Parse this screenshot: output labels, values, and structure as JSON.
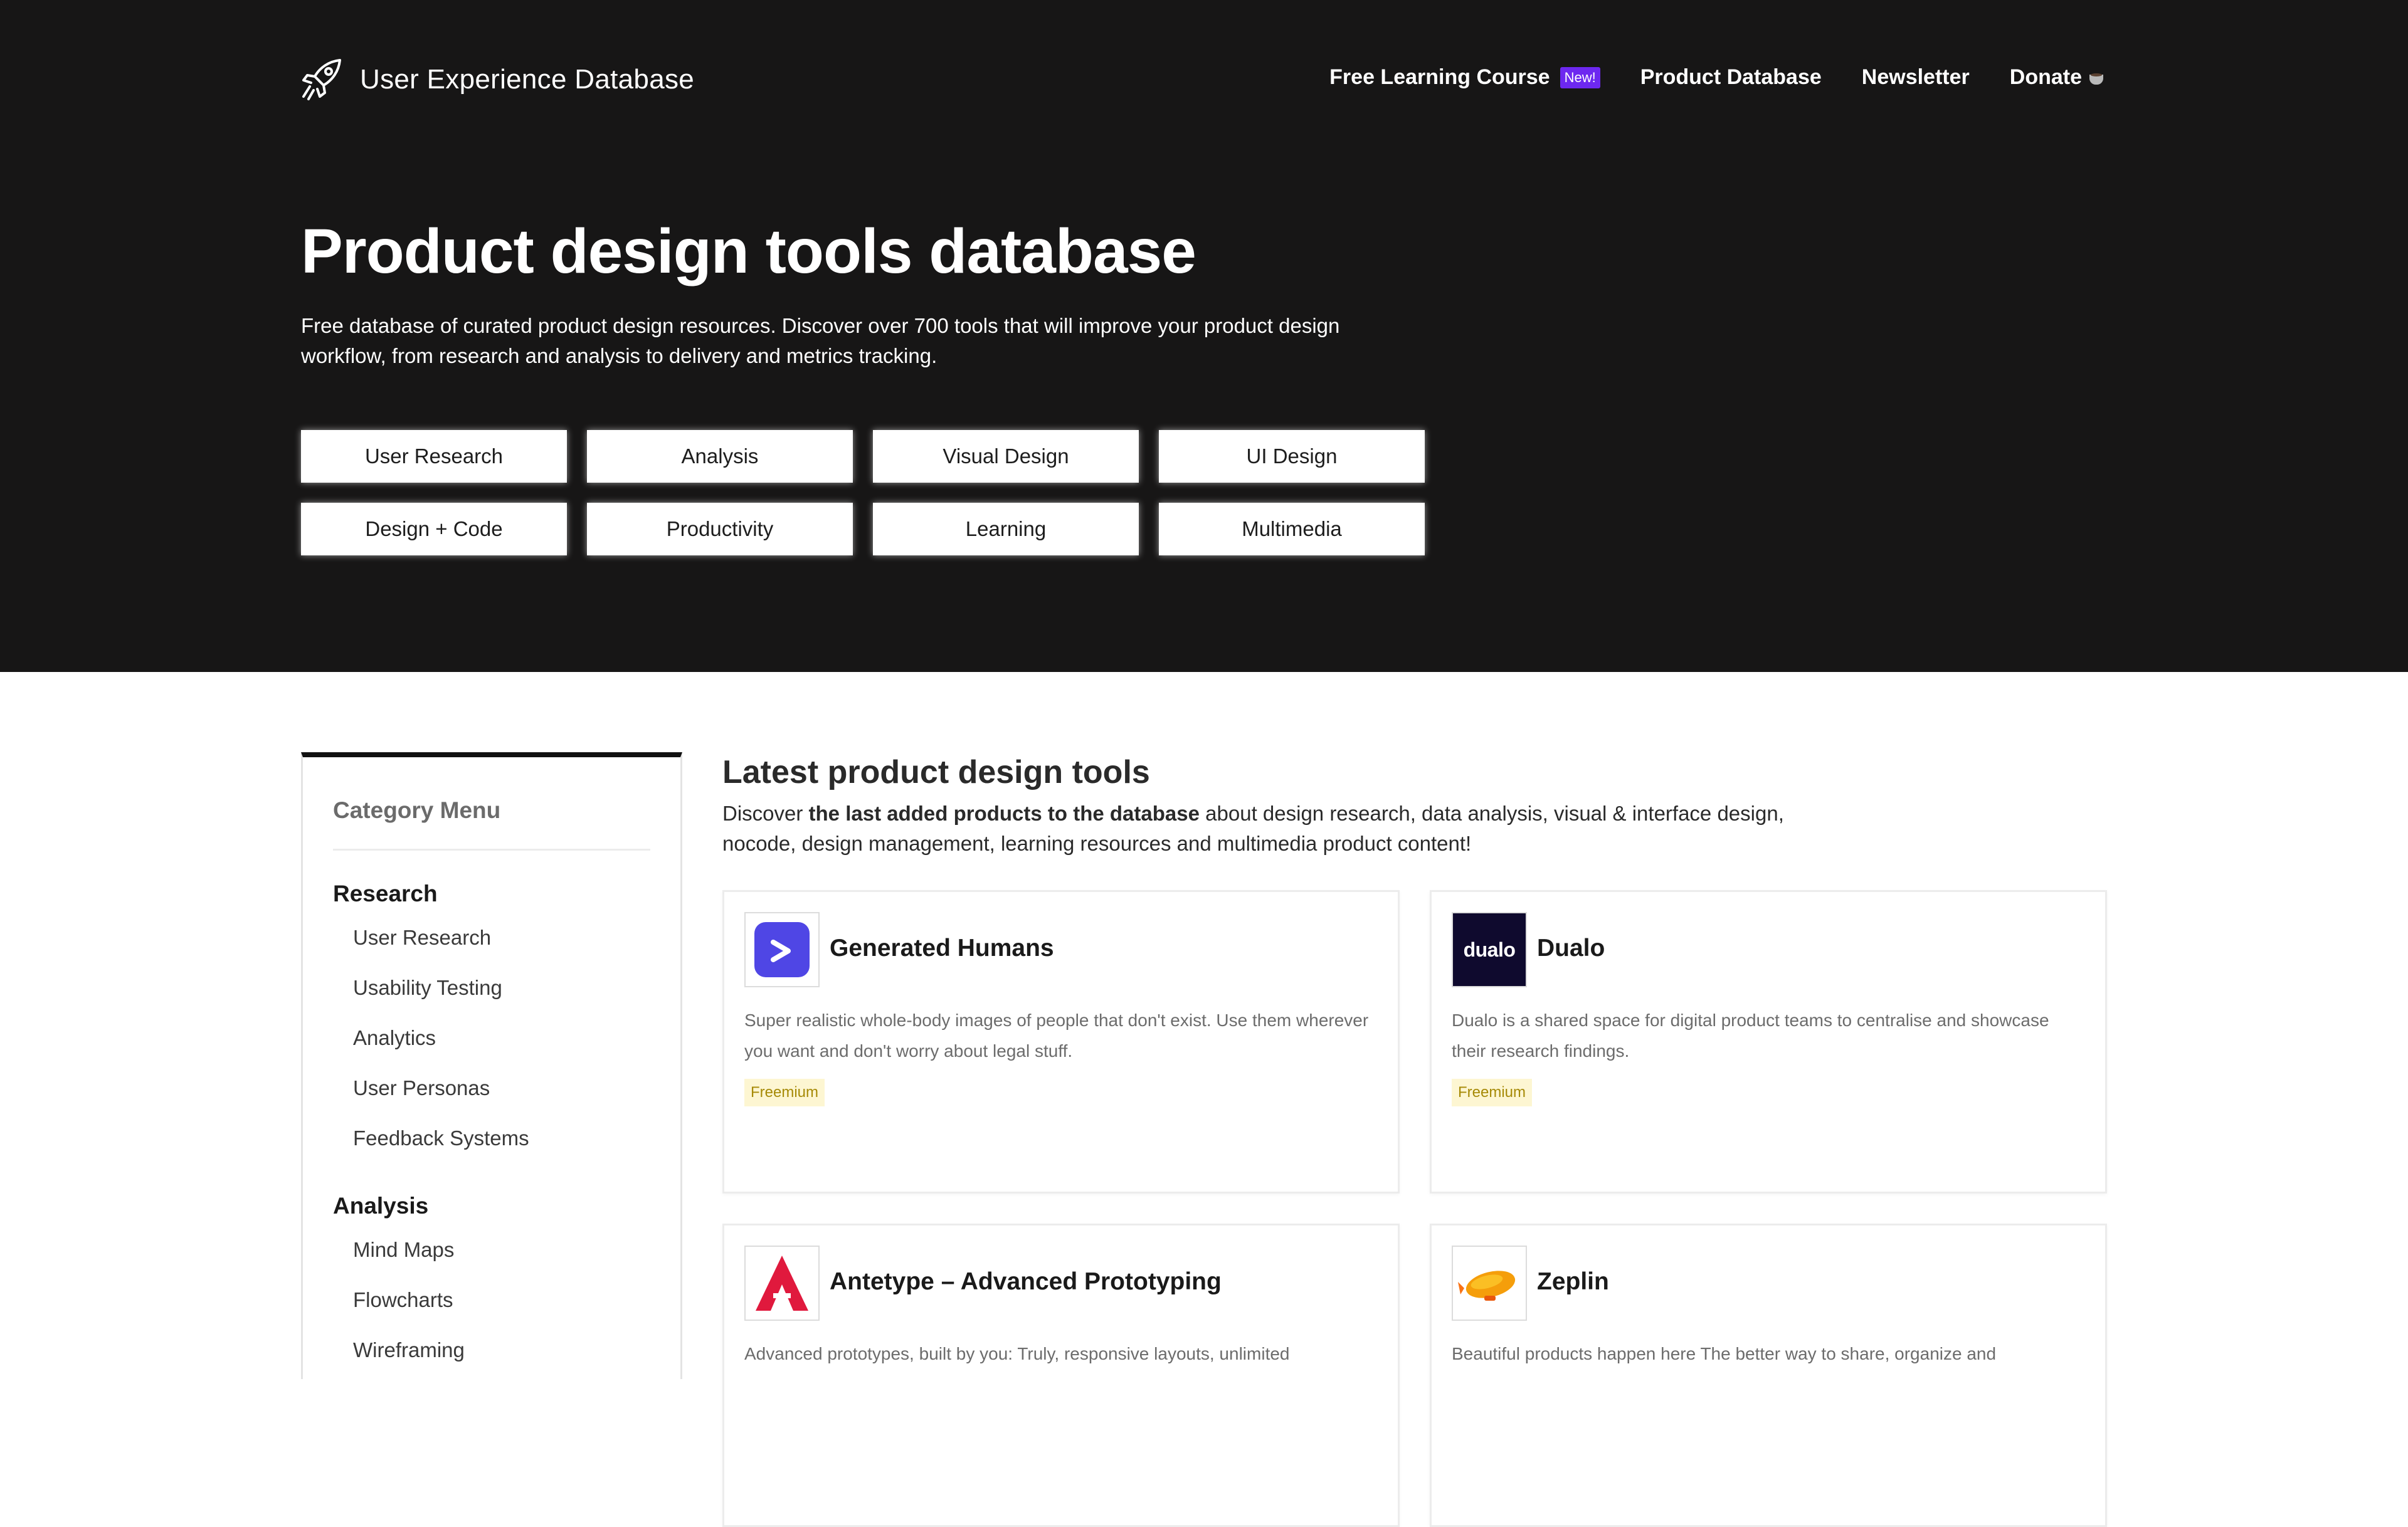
{
  "header": {
    "site_title": "User Experience Database",
    "nav": [
      {
        "label": "Free Learning Course",
        "badge": "New!"
      },
      {
        "label": "Product Database"
      },
      {
        "label": "Newsletter"
      },
      {
        "label": "Donate"
      }
    ]
  },
  "hero": {
    "title": "Product design tools database",
    "description": "Free database of curated product design resources. Discover over 700 tools that will improve your product design workflow, from research and analysis to delivery and metrics tracking.",
    "categories": [
      "User Research",
      "Analysis",
      "Visual Design",
      "UI Design",
      "Design + Code",
      "Productivity",
      "Learning",
      "Multimedia"
    ]
  },
  "sidebar": {
    "title": "Category Menu",
    "sections": [
      {
        "heading": "Research",
        "items": [
          "User Research",
          "Usability Testing",
          "Analytics",
          "User Personas",
          "Feedback Systems"
        ]
      },
      {
        "heading": "Analysis",
        "items": [
          "Mind Maps",
          "Flowcharts",
          "Wireframing"
        ]
      }
    ]
  },
  "main": {
    "title": "Latest product design tools",
    "desc_prefix": "Discover ",
    "desc_bold": "the last added products to the database",
    "desc_suffix": " about design research, data analysis, visual & interface design, nocode, design management, learning resources and multimedia product content!",
    "cards": [
      {
        "name": "Generated Humans",
        "description": "Super realistic whole-body images of people that don't exist. Use them wherever you want and don't worry about legal stuff.",
        "badge": "Freemium",
        "logo_icon": "generated-humans-logo",
        "logo_color": "#4f46e5"
      },
      {
        "name": "Dualo",
        "description": "Dualo is a shared space for digital product teams to centralise and showcase their research findings.",
        "badge": "Freemium",
        "logo_icon": "dualo-logo",
        "logo_text": "dualo",
        "logo_color": "#0f0a2e"
      },
      {
        "name": "Antetype – Advanced Prototyping",
        "description": "Advanced prototypes, built by you: Truly, responsive layouts, unlimited",
        "logo_icon": "antetype-logo",
        "logo_color": "#e0193d"
      },
      {
        "name": "Zeplin",
        "description": "Beautiful products happen here The better way to share, organize and",
        "logo_icon": "zeplin-logo",
        "logo_color": "#f59e0b"
      }
    ]
  }
}
